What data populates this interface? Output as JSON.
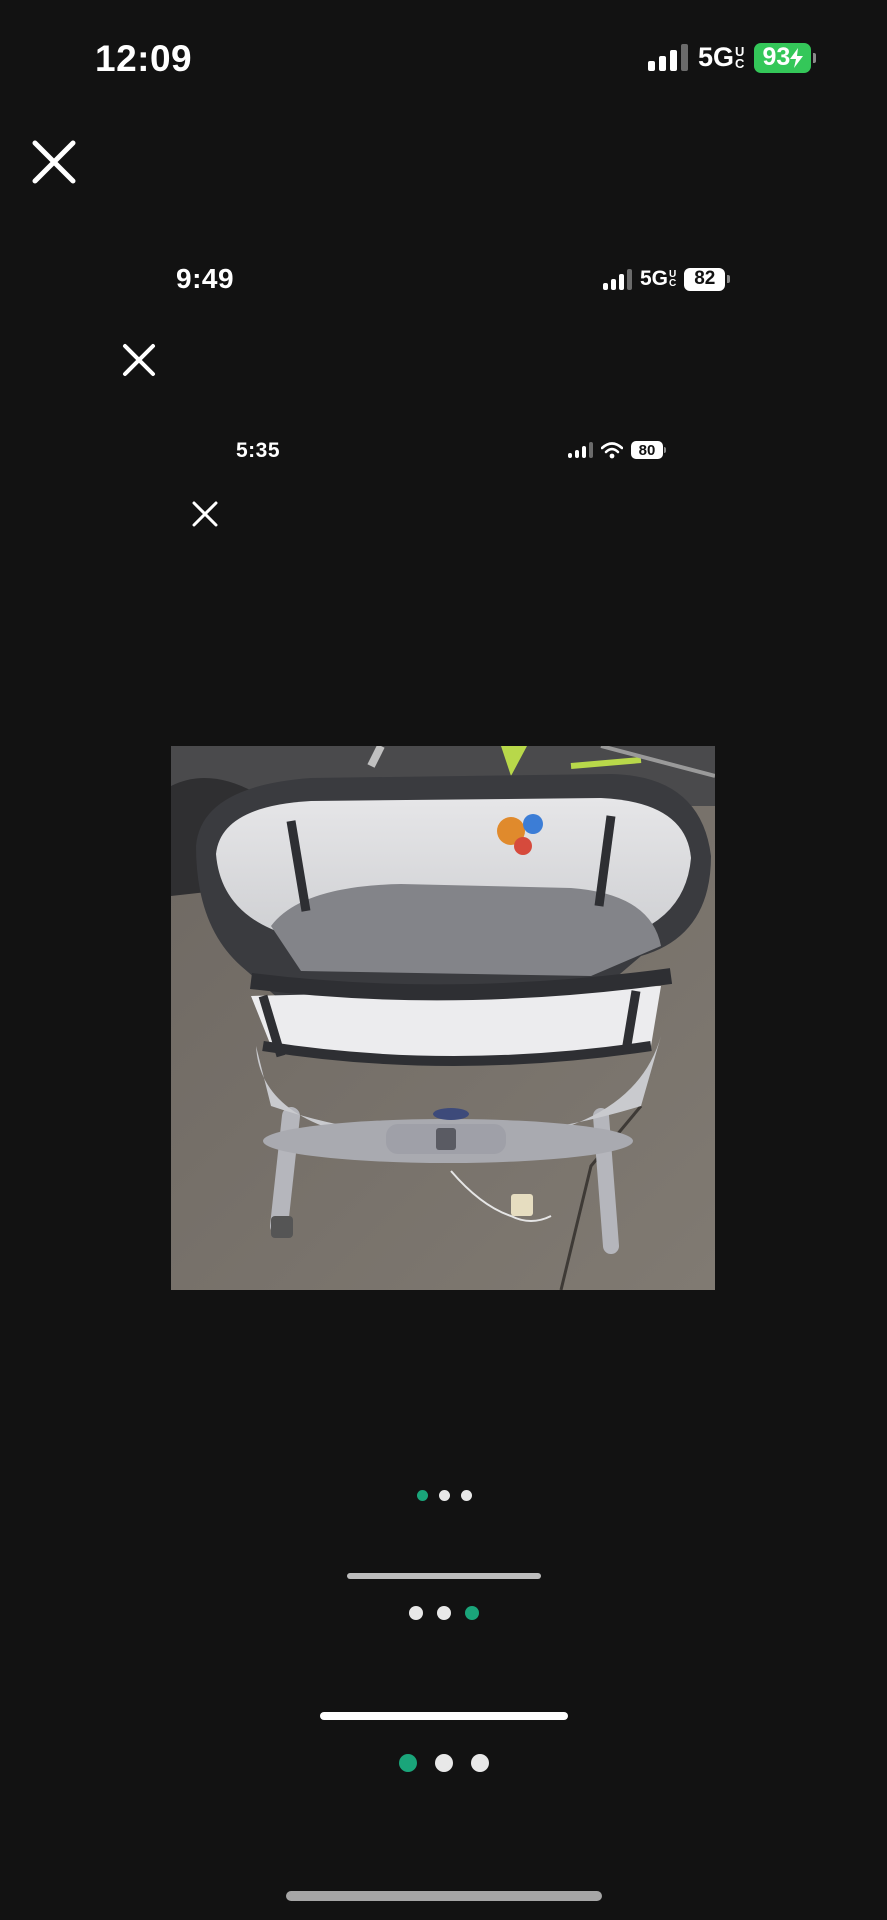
{
  "status_outer": {
    "time": "12:09",
    "network": "5G",
    "network_sup": [
      "U",
      "C"
    ],
    "battery": "93",
    "battery_color": "#34c759"
  },
  "status_mid": {
    "time": "9:49",
    "network": "5G",
    "network_sup": [
      "U",
      "C"
    ],
    "battery": "82"
  },
  "status_inner": {
    "time": "5:35",
    "battery": "80"
  },
  "icons": {
    "close": "close-icon",
    "signal": "cellular-signal-icon",
    "wifi": "wifi-icon",
    "battery": "battery-icon",
    "charging": "bolt-icon"
  },
  "photo": {
    "subject": "bassinet-photo"
  },
  "pagers": [
    {
      "count": 3,
      "active": 0
    },
    {
      "count": 3,
      "active": 2
    },
    {
      "count": 3,
      "active": 0
    }
  ],
  "colors": {
    "background": "#121212",
    "accent": "#1aa57a",
    "battery_charging": "#34c759"
  }
}
